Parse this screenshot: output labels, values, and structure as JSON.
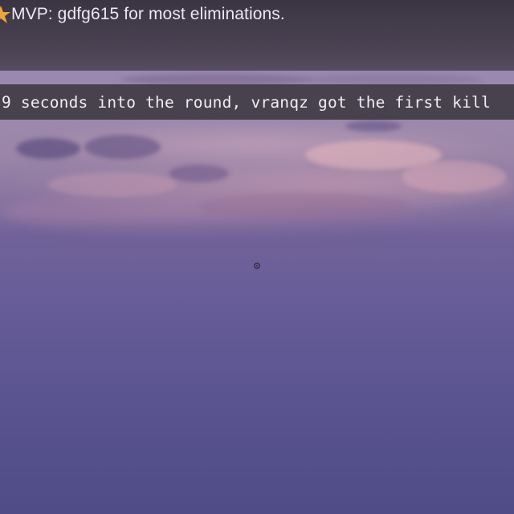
{
  "mvp_banner": {
    "icon": "star-icon",
    "text": "MVP: gdfg615 for most eliminations."
  },
  "kill_feed": {
    "message": "9 seconds into the round, vranqz got the first kill"
  },
  "crosshair": {
    "icon": "crosshair-icon"
  },
  "colors": {
    "star": "#e8a640",
    "banner_bg": "#3a343f",
    "strip_bg": "#3a363e",
    "text": "#f0eef4",
    "sky_top": "#8a7aa3",
    "sky_bottom": "#4f4c88"
  }
}
